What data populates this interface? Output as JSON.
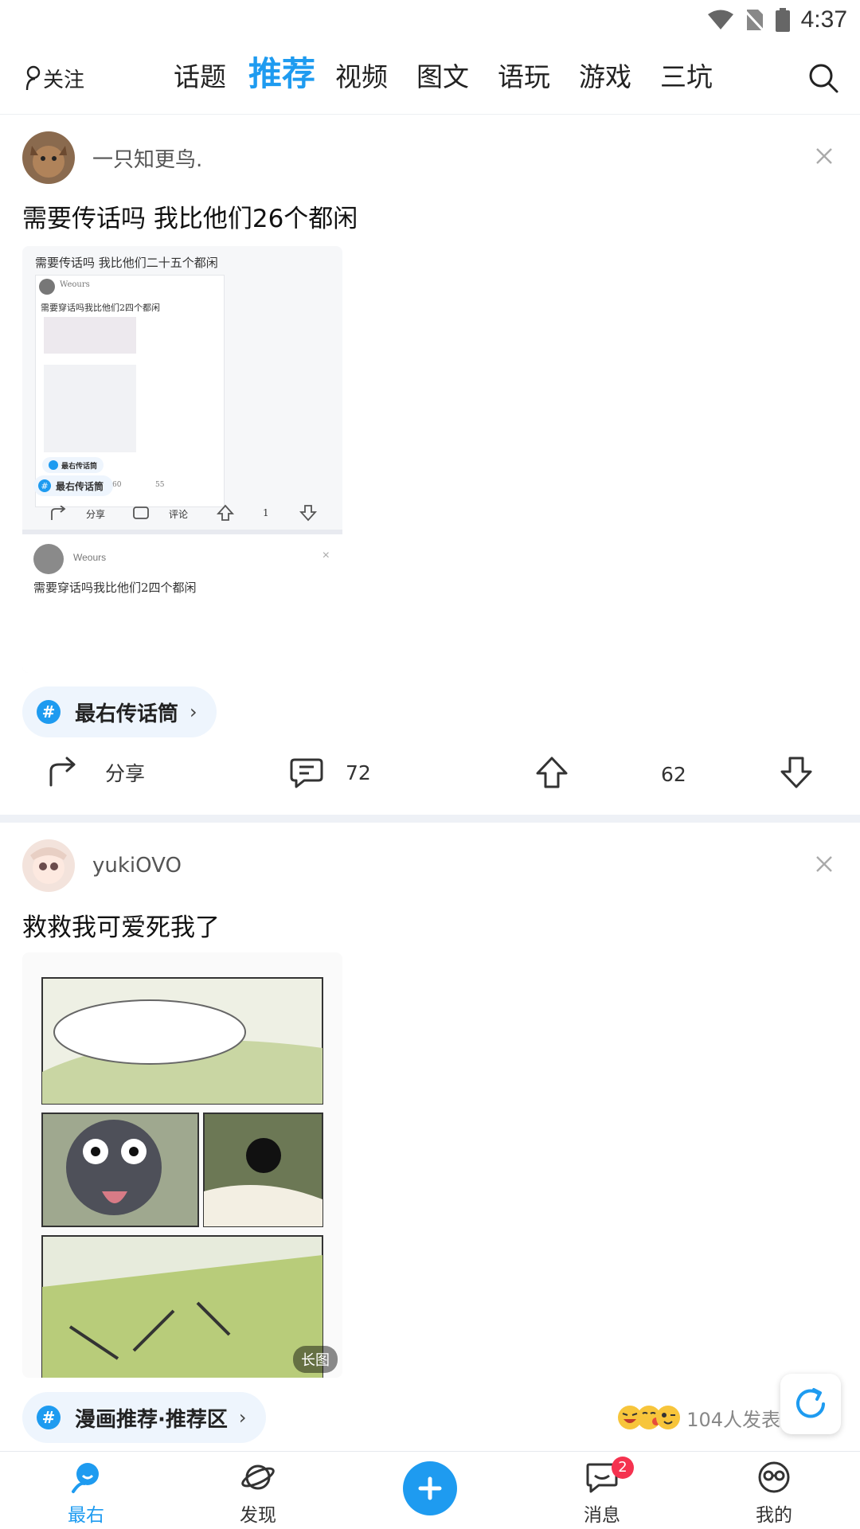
{
  "status_bar": {
    "time": "4:37",
    "icons": [
      "wifi-icon",
      "no-sim-icon",
      "battery-icon"
    ]
  },
  "top_nav": {
    "follow_label": "关注",
    "tabs": [
      "话题",
      "推荐",
      "视频",
      "图文",
      "语玩",
      "游戏",
      "三坑"
    ],
    "active_tab": "推荐"
  },
  "posts": [
    {
      "username": "一只知更鸟.",
      "text": "需要传话吗  我比他们26个都闲",
      "image_texts": {
        "title": "需要传话吗  我比他们二十五个都闲",
        "inner_user": "Weours",
        "inner_text": "需要穿话吗我比他们2四个都闲",
        "inner_topic": "最右传话筒",
        "share": "分享",
        "comment": "评论",
        "up": "1",
        "small_share": "分享",
        "small_comment": "60",
        "small_up": "55",
        "bottom_user": "Weours",
        "bottom_text": "需要穿话吗我比他们2四个都闲"
      },
      "topic": "最右传话筒",
      "share_label": "分享",
      "comment_count": "72",
      "like_count": "62"
    },
    {
      "username": "yukiOVO",
      "text": "救救我可爱死我了",
      "image_badge": "长图",
      "topic": "漫画推荐·推荐区",
      "reaction_text": "104人发表"
    }
  ],
  "bottom_nav": {
    "items": [
      "最右",
      "发现",
      "消息",
      "我的"
    ],
    "active": "最右",
    "message_badge": "2"
  },
  "colors": {
    "accent": "#1e9bf0",
    "badge": "#f5324f",
    "chip_bg": "#eef5fd"
  }
}
